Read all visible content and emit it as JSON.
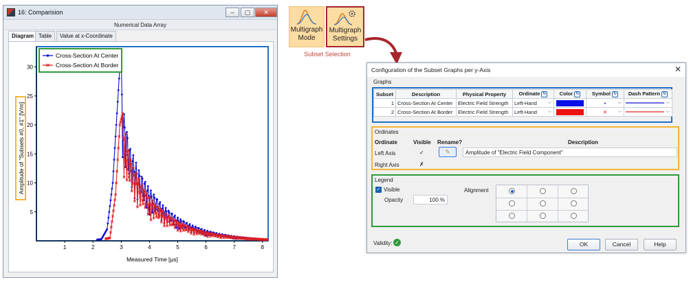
{
  "window": {
    "title": "16: Comparision",
    "controls": [
      "–",
      "▢",
      "✕"
    ],
    "section_title": "Numerical Data Array",
    "tabs": [
      "Diagram",
      "Table",
      "Value at x-Coordinate"
    ]
  },
  "chart_data": {
    "type": "line",
    "xlabel": "Measured Time [µs]",
    "ylabel": "Amplitude of \"Subsets #0, #1\" [V/m]",
    "xlim": [
      0,
      8.2
    ],
    "ylim": [
      0,
      33.5
    ],
    "xticks": [
      1,
      2,
      3,
      4,
      5,
      6,
      7,
      8
    ],
    "yticks": [
      5,
      10,
      15,
      20,
      25,
      30
    ],
    "legend_position": "top-left",
    "series": [
      {
        "name": "Cross-Section At Center",
        "color": "#1010d0",
        "marker": "dot",
        "envelope": {
          "x": [
            2.3,
            2.5,
            2.7,
            2.85,
            2.95,
            3.0,
            3.1,
            3.3,
            3.6,
            4.0,
            4.5,
            5.0,
            5.5,
            6.0,
            6.5,
            7.0,
            7.5,
            8.0,
            8.2
          ],
          "y": [
            0.3,
            2.0,
            10.0,
            22.0,
            30.0,
            31.5,
            22.0,
            16.5,
            12.5,
            9.0,
            6.0,
            4.0,
            2.7,
            1.8,
            1.2,
            0.8,
            0.5,
            0.3,
            0.25
          ]
        }
      },
      {
        "name": "Cross-Section At Border",
        "color": "#e02020",
        "marker": "x",
        "envelope": {
          "x": [
            2.6,
            2.8,
            2.95,
            3.05,
            3.2,
            3.4,
            3.7,
            4.0,
            4.5,
            5.0,
            5.5,
            6.0,
            6.5,
            7.0,
            7.5,
            8.0,
            8.2
          ],
          "y": [
            0.5,
            8.0,
            20.0,
            22.0,
            17.0,
            13.0,
            10.0,
            7.5,
            5.0,
            3.3,
            2.2,
            1.5,
            1.0,
            0.7,
            0.45,
            0.3,
            0.25
          ]
        }
      }
    ]
  },
  "ribbon": {
    "mode_line1": "Multigraph",
    "mode_line2": "Mode",
    "settings_line1": "Multigraph",
    "settings_line2": "Settings",
    "caption": "Subset Selection"
  },
  "dialog": {
    "title": "Configuration of the Subset Graphs per y-Axis",
    "graphs": {
      "label": "Graphs",
      "headers": [
        "Subset",
        "Description",
        "Physical Property",
        "Ordinate",
        "Color",
        "Symbol",
        "Dash Pattern"
      ],
      "rows": [
        {
          "subset": "1",
          "description": "Cross-Section At Center",
          "property": "Electric Field Strength",
          "ordinate": "Left-Hand",
          "color": "#0a10e8",
          "symbol": "•",
          "symbol_color": "#1010d0"
        },
        {
          "subset": "2",
          "description": "Cross-Section At Border",
          "property": "Electric Field Strength",
          "ordinate": "Left-Hand",
          "color": "#ee1111",
          "symbol": "✕",
          "symbol_color": "#e02020"
        }
      ]
    },
    "ordinates": {
      "label": "Ordinates",
      "headers": [
        "Ordinate",
        "Visible",
        "Rename?",
        "Description"
      ],
      "rows": [
        {
          "name": "Left Axis",
          "visible": "✓",
          "description": "Amplitude of \"Electric Field Component\""
        },
        {
          "name": "Right Axis",
          "visible": "✗",
          "description": ""
        }
      ]
    },
    "legend": {
      "label": "Legend",
      "visible_label": "Visible",
      "opacity_label": "Opacity",
      "opacity_value": "100 %",
      "alignment_label": "Alignment",
      "selected_alignment": "top-left"
    },
    "validity_label": "Validity:",
    "ok": "OK",
    "cancel": "Cancel",
    "help": "Help"
  },
  "highlight_colors": {
    "blue": "#1f6fc6",
    "green": "#2e9a38",
    "orange": "#f5b533",
    "red": "#a6272c"
  }
}
